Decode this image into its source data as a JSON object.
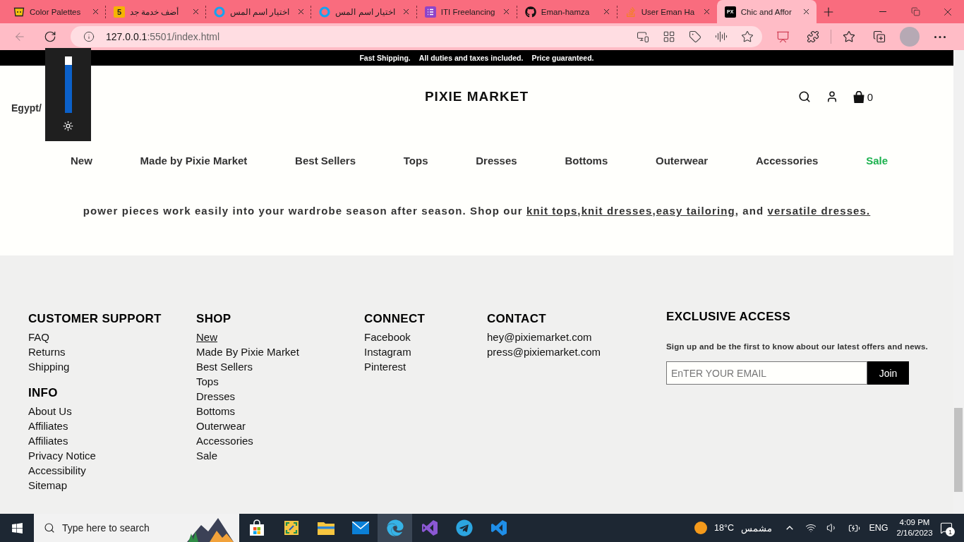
{
  "browser": {
    "tabs": [
      {
        "title": "Color Palettes",
        "kind": "cup",
        "selected": false
      },
      {
        "title": "أضف خدمة جد",
        "kind": "tile",
        "icon_text": "5",
        "selected": false
      },
      {
        "title": "اختيار اسم المس",
        "kind": "ring",
        "selected": false
      },
      {
        "title": "اختيار اسم المس",
        "kind": "ring",
        "selected": false
      },
      {
        "title": "ITI Freelancing",
        "kind": "list",
        "selected": false
      },
      {
        "title": "Eman-hamza",
        "kind": "cat",
        "selected": false
      },
      {
        "title": "User Eman Ha",
        "kind": "stack",
        "selected": false
      },
      {
        "title": "Chic and Affor",
        "kind": "tile_dark",
        "icon_text": "PX",
        "selected": true
      }
    ],
    "back_disabled": true,
    "url": {
      "host": "127.0.0.1",
      "path": ":5501/index.html"
    }
  },
  "brightness": {
    "level": 0.85
  },
  "banner": [
    "Fast Shipping.",
    "All duties and taxes included.",
    "Price guaranteed."
  ],
  "header": {
    "region": "Egypt/",
    "logo": "PIXIE MARKET",
    "cart_count": "0"
  },
  "nav": [
    {
      "label": "New",
      "color": "#333333"
    },
    {
      "label": "Made by Pixie Market",
      "color": "#333333"
    },
    {
      "label": "Best Sellers",
      "color": "#333333"
    },
    {
      "label": "Tops",
      "color": "#333333"
    },
    {
      "label": "Dresses",
      "color": "#333333"
    },
    {
      "label": "Bottoms",
      "color": "#333333"
    },
    {
      "label": "Outerwear",
      "color": "#333333"
    },
    {
      "label": "Accessories",
      "color": "#333333"
    },
    {
      "label": "Sale",
      "color": "#1cb24e"
    }
  ],
  "intro": [
    {
      "kind": "text",
      "text": "power pieces work easily into your wardrobe season after season. Shop our "
    },
    {
      "kind": "link",
      "text": "knit tops"
    },
    {
      "kind": "text",
      "text": ","
    },
    {
      "kind": "link",
      "text": "knit dresses"
    },
    {
      "kind": "text",
      "text": ","
    },
    {
      "kind": "link",
      "text": "easy tailoring"
    },
    {
      "kind": "text",
      "text": ", and "
    },
    {
      "kind": "link",
      "text": "versatile dresses."
    }
  ],
  "footer": {
    "columns": [
      {
        "sections": [
          {
            "heading": "CUSTOMER SUPPORT",
            "links": [
              {
                "label": "FAQ"
              },
              {
                "label": "Returns"
              },
              {
                "label": "Shipping"
              }
            ]
          },
          {
            "heading": "INFO",
            "links": [
              {
                "label": "About Us"
              },
              {
                "label": "Affiliates"
              },
              {
                "label": "Affiliates"
              },
              {
                "label": "Privacy Notice"
              },
              {
                "label": "Accessibility"
              },
              {
                "label": "Sitemap"
              }
            ]
          }
        ]
      },
      {
        "sections": [
          {
            "heading": "SHOP",
            "links": [
              {
                "label": "New",
                "selected": true
              },
              {
                "label": "Made By Pixie Market",
                "selected": false
              },
              {
                "label": "Best Sellers",
                "selected": false
              },
              {
                "label": "Tops",
                "selected": false
              },
              {
                "label": "Dresses",
                "selected": false
              },
              {
                "label": "Bottoms",
                "selected": false
              },
              {
                "label": "Outerwear",
                "selected": false
              },
              {
                "label": "Accessories",
                "selected": false
              },
              {
                "label": "Sale",
                "selected": false
              }
            ]
          }
        ]
      },
      {
        "sections": [
          {
            "heading": "CONNECT",
            "links": [
              {
                "label": "Facebook"
              },
              {
                "label": "Instagram"
              },
              {
                "label": "Pinterest"
              }
            ]
          }
        ]
      },
      {
        "sections": [
          {
            "heading": "CONTACT",
            "links": [
              {
                "label": "hey@pixiemarket.com"
              },
              {
                "label": "press@pixiemarket.com"
              }
            ]
          }
        ]
      }
    ],
    "newsletter": {
      "heading": "EXCLUSIVE ACCESS",
      "text": "Sign up and be the first to know about our latest offers and news.",
      "placeholder": "EnTER YOUR EMAIL",
      "button": "Join"
    }
  },
  "taskbar": {
    "search_placeholder": "Type here to search",
    "apps": [
      {
        "kind": "store",
        "selected": false
      },
      {
        "kind": "snip",
        "selected": false
      },
      {
        "kind": "folder",
        "selected": false
      },
      {
        "kind": "mail",
        "selected": false
      },
      {
        "kind": "edge",
        "selected": true
      },
      {
        "kind": "studio",
        "selected": false
      },
      {
        "kind": "telegram",
        "selected": false
      },
      {
        "kind": "code",
        "selected": false
      }
    ],
    "weather": {
      "temperature": "18°C",
      "condition": "مشمس"
    },
    "language": "ENG",
    "time": "4:09 PM",
    "date": "2/16/2023",
    "notifications": "1"
  }
}
